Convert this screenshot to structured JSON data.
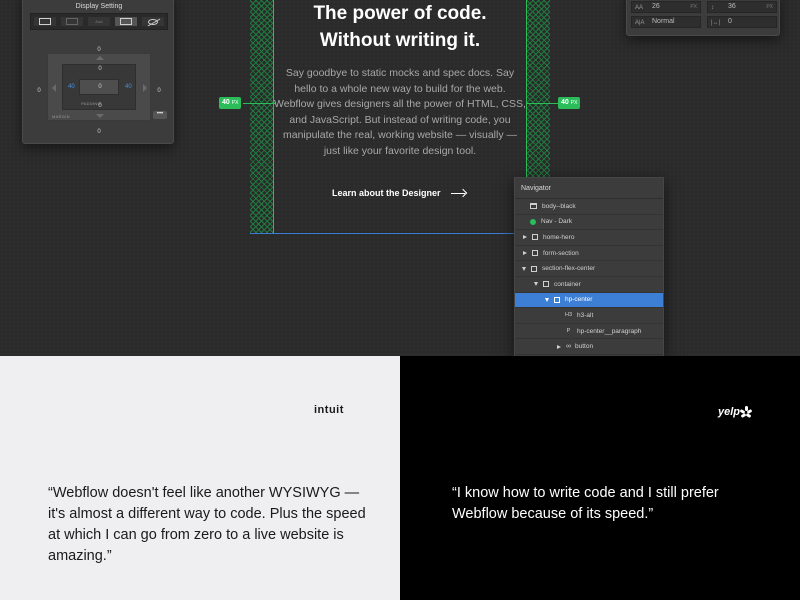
{
  "style_panel": {
    "display_setting_label": "Display Setting",
    "display_buttons": [
      "block",
      "inline-block",
      "inline",
      "flex",
      "none"
    ],
    "margin": {
      "top": "0",
      "right": "0",
      "bottom": "0",
      "left": "0"
    },
    "padding": {
      "top": "0",
      "right": "40",
      "bottom": "0",
      "left": "40"
    },
    "padding_label": "PADDING",
    "margin_label": "MARGIN",
    "inner_top": "0",
    "more_label": "•••"
  },
  "type_panel": {
    "size_value": "26",
    "size_unit": "PX",
    "line_height_value": "36",
    "line_height_unit": "PX",
    "letter_spacing_value": "Normal",
    "word_spacing_value": "0"
  },
  "hero": {
    "title_line1": "The power of code.",
    "title_line2": "Without writing it.",
    "paragraph": "Say goodbye to static mocks and spec docs. Say hello to a whole new way to build for the web. Webflow gives designers all the power of HTML, CSS, and JavaScript. But instead of writing code, you manipulate the real, working website — visually — just like your favorite design tool.",
    "link_label": "Learn about the Designer",
    "padding_left_value": "40",
    "padding_right_value": "40",
    "padding_unit": "PX"
  },
  "navigator": {
    "title": "Navigator",
    "items": [
      {
        "label": "body--black",
        "icon": "body-icon",
        "caret": "none"
      },
      {
        "label": "Nav - Dark",
        "icon": "symbol-icon",
        "caret": "none"
      },
      {
        "label": "home-hero",
        "icon": "box-icon",
        "caret": "right"
      },
      {
        "label": "form-section",
        "icon": "box-icon",
        "caret": "right"
      },
      {
        "label": "section-flex-center",
        "icon": "box-icon",
        "caret": "down"
      },
      {
        "label": "container",
        "icon": "box-icon",
        "caret": "down"
      },
      {
        "label": "hp-center",
        "icon": "box-icon",
        "caret": "down"
      },
      {
        "label": "h3-alt",
        "icon": "H3",
        "caret": "none"
      },
      {
        "label": "hp-center__paragraph",
        "icon": "P",
        "caret": "none"
      },
      {
        "label": "button",
        "icon": "link-icon",
        "caret": "right"
      }
    ]
  },
  "testimonials": {
    "left": {
      "logo": "intuit",
      "quote": "“Webflow doesn't feel like another WYSIWYG — it's almost a different way to code. Plus the speed at which I can go from zero to a live website is amazing.”"
    },
    "right": {
      "logo": "yelp",
      "quote": "“I know how to write code and I still prefer Webflow because of its speed.”"
    }
  },
  "colors": {
    "accent_green": "#2bbd5a",
    "selection_blue": "#3e7fd6",
    "canvas_dark": "#2b2b2b"
  }
}
